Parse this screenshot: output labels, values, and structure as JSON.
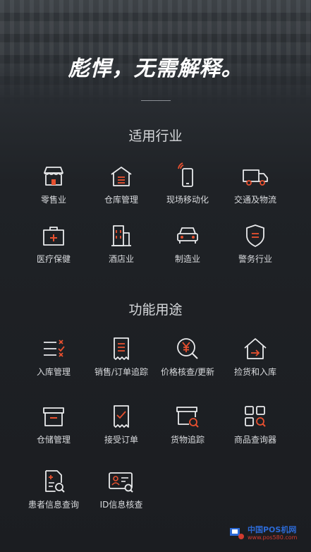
{
  "hero": {
    "title": "彪悍，无需解释。"
  },
  "industries": {
    "title": "适用行业",
    "items": [
      {
        "label": "零售业",
        "icon": "store-icon"
      },
      {
        "label": "仓库管理",
        "icon": "warehouse-icon"
      },
      {
        "label": "现场移动化",
        "icon": "mobile-signal-icon"
      },
      {
        "label": "交通及物流",
        "icon": "truck-icon"
      },
      {
        "label": "医疗保健",
        "icon": "medical-kit-icon"
      },
      {
        "label": "酒店业",
        "icon": "hotel-building-icon"
      },
      {
        "label": "制造业",
        "icon": "car-icon"
      },
      {
        "label": "警务行业",
        "icon": "police-badge-icon"
      }
    ]
  },
  "functions": {
    "title": "功能用途",
    "items": [
      {
        "label": "入库管理",
        "icon": "checklist-icon"
      },
      {
        "label": "销售/订单追踪",
        "icon": "receipt-icon"
      },
      {
        "label": "价格核查/更新",
        "icon": "price-search-icon"
      },
      {
        "label": "捡货和入库",
        "icon": "home-arrow-icon"
      },
      {
        "label": "仓储管理",
        "icon": "storage-box-icon"
      },
      {
        "label": "接受订单",
        "icon": "order-check-icon"
      },
      {
        "label": "货物追踪",
        "icon": "goods-tracking-icon"
      },
      {
        "label": "商品查询器",
        "icon": "product-grid-search-icon"
      },
      {
        "label": "患者信息查询",
        "icon": "patient-record-icon"
      },
      {
        "label": "ID信息核查",
        "icon": "id-card-search-icon"
      }
    ]
  },
  "watermark": {
    "line1": "中国POS机网",
    "line2": "www.pos580.com"
  },
  "colors": {
    "accent": "#e8502f",
    "icon_stroke": "#e9eaec",
    "text": "#d9dbde"
  }
}
